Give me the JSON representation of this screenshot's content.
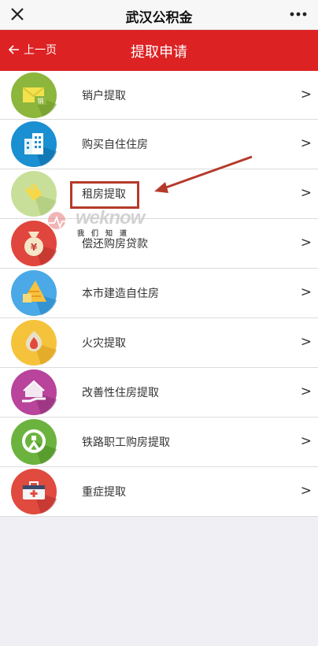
{
  "window": {
    "title": "武汉公积金"
  },
  "header": {
    "back_label": "上一页",
    "title": "提取申请"
  },
  "items": [
    {
      "label": "销户提取",
      "icon": "envelope-icon",
      "icon_color": "#8cb63c",
      "chevron": ">"
    },
    {
      "label": "购买自住住房",
      "icon": "building-icon",
      "icon_color": "#1a8fd1",
      "chevron": ">"
    },
    {
      "label": "租房提取",
      "icon": "tag-icon",
      "icon_color": "#c8df9a",
      "chevron": ">"
    },
    {
      "label": "偿还购房贷款",
      "icon": "money-bag-icon",
      "icon_color": "#e0463e",
      "chevron": ">"
    },
    {
      "label": "本市建造自住房",
      "icon": "bricks-icon",
      "icon_color": "#4aa9e6",
      "chevron": ">"
    },
    {
      "label": "火灾提取",
      "icon": "fire-icon",
      "icon_color": "#f5c33b",
      "chevron": ">"
    },
    {
      "label": "改善性住房提取",
      "icon": "house-hand-icon",
      "icon_color": "#b9449b",
      "chevron": ">"
    },
    {
      "label": "铁路职工购房提取",
      "icon": "railway-icon",
      "icon_color": "#6bb33e",
      "chevron": ">"
    },
    {
      "label": "重症提取",
      "icon": "medical-kit-icon",
      "icon_color": "#e04a3f",
      "chevron": ">"
    }
  ],
  "watermark": {
    "brand": "weknow",
    "subtitle": "我们知道"
  },
  "colors": {
    "header_bg": "#dd2224",
    "annotation": "#b53a2a"
  }
}
